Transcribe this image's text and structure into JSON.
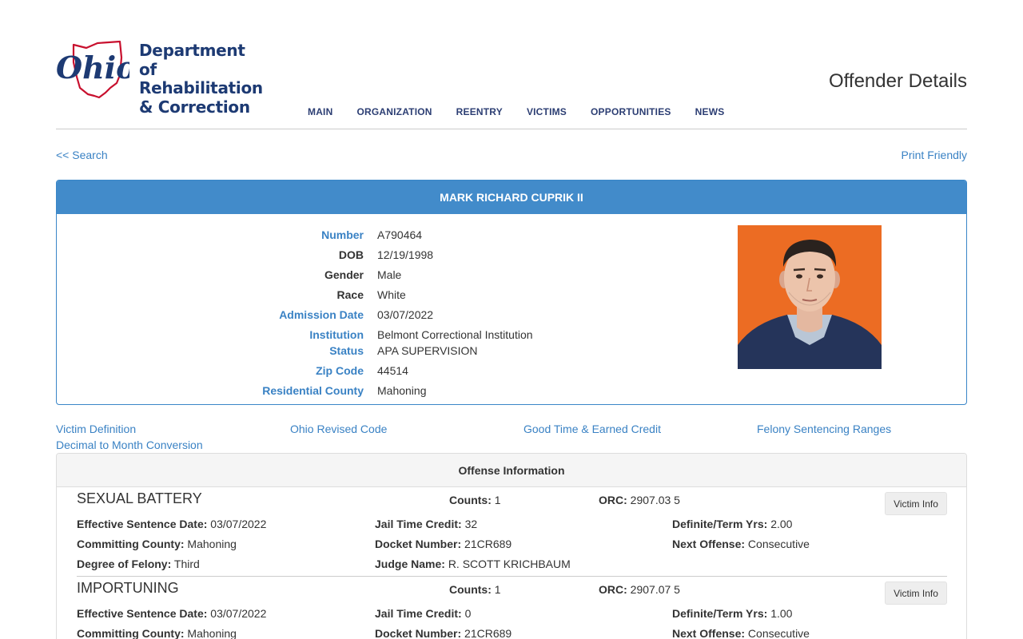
{
  "header": {
    "logo_lines": [
      "Department of",
      "Rehabilitation",
      "& Correction"
    ],
    "logo_script": "Ohio",
    "page_heading": "Offender Details",
    "nav": [
      "MAIN",
      "ORGANIZATION",
      "REENTRY",
      "VICTIMS",
      "OPPORTUNITIES",
      "NEWS"
    ]
  },
  "links": {
    "back": "<< Search",
    "print": "Print Friendly"
  },
  "offender": {
    "name": "MARK RICHARD CUPRIK II",
    "fields": [
      {
        "label": "Number",
        "value": "A790464",
        "link": true
      },
      {
        "label": "DOB",
        "value": "12/19/1998",
        "link": false
      },
      {
        "label": "Gender",
        "value": "Male",
        "link": false
      },
      {
        "label": "Race",
        "value": "White",
        "link": false
      },
      {
        "label": "Admission Date",
        "value": "03/07/2022",
        "link": true
      },
      {
        "label": "Institution",
        "value": "Belmont Correctional Institution",
        "link": true
      },
      {
        "label": "Status",
        "value": "APA SUPERVISION",
        "link": true
      },
      {
        "label": "Zip Code",
        "value": "44514",
        "link": true
      },
      {
        "label": "Residential County",
        "value": "Mahoning",
        "link": true
      }
    ]
  },
  "resources": [
    "Victim Definition",
    "Ohio Revised Code",
    "Good Time & Earned Credit",
    "Felony Sentencing Ranges",
    "Decimal to Month Conversion"
  ],
  "offense_panel": {
    "title": "Offense Information",
    "victim_button": "Victim Info",
    "labels": {
      "counts": "Counts:",
      "orc": "ORC:",
      "effective": "Effective Sentence Date:",
      "jail": "Jail Time Credit:",
      "term": "Definite/Term Yrs:",
      "county": "Committing County:",
      "docket": "Docket Number:",
      "next": "Next Offense:",
      "degree": "Degree of Felony:",
      "judge": "Judge Name:"
    },
    "offenses": [
      {
        "title": "SEXUAL BATTERY",
        "counts": "1",
        "orc": "2907.03 5",
        "effective": "03/07/2022",
        "jail": "32",
        "term": "2.00",
        "county": "Mahoning",
        "docket": "21CR689",
        "next": "Consecutive",
        "degree": "Third",
        "judge": "R. SCOTT KRICHBAUM"
      },
      {
        "title": "IMPORTUNING",
        "counts": "1",
        "orc": "2907.07 5",
        "effective": "03/07/2022",
        "jail": "0",
        "term": "1.00",
        "county": "Mahoning",
        "docket": "21CR689",
        "next": "Consecutive"
      }
    ]
  }
}
